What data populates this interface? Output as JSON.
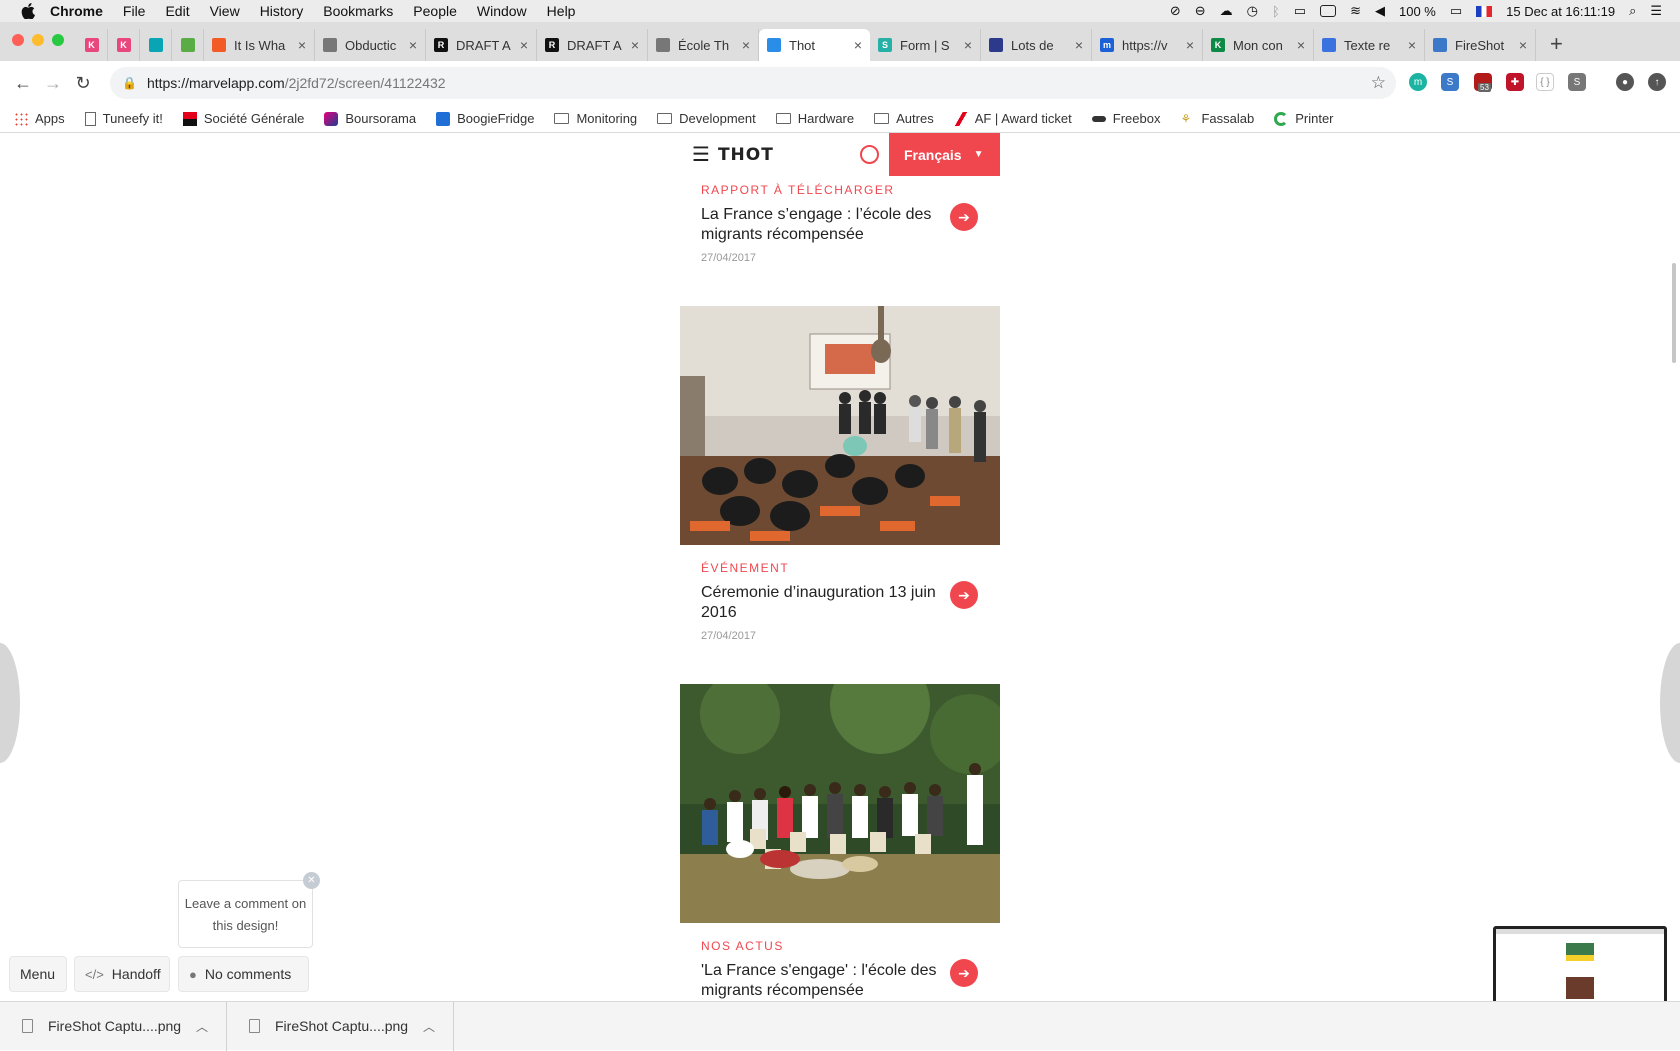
{
  "menubar": {
    "app": "Chrome",
    "items": [
      "File",
      "Edit",
      "View",
      "History",
      "Bookmarks",
      "People",
      "Window",
      "Help"
    ],
    "battery": "100 %",
    "datetime": "15 Dec at  16:11:19"
  },
  "tabs": [
    {
      "title": "",
      "color": "#e8467c",
      "letter": "K"
    },
    {
      "title": "",
      "color": "#e8467c",
      "letter": "K"
    },
    {
      "title": "",
      "color": "#0aa5b5",
      "letter": ""
    },
    {
      "title": "",
      "color": "#5aac44",
      "letter": ""
    },
    {
      "title": "It Is Wha",
      "color": "#f25b25",
      "letter": ""
    },
    {
      "title": "Obductic",
      "color": "#777777",
      "letter": ""
    },
    {
      "title": "DRAFT A",
      "color": "#111111",
      "letter": "R"
    },
    {
      "title": "DRAFT A",
      "color": "#111111",
      "letter": "R"
    },
    {
      "title": "École Th",
      "color": "#777777",
      "letter": ""
    },
    {
      "title": "Thot",
      "color": "#2a8ee8",
      "letter": "",
      "active": true
    },
    {
      "title": "Form | S",
      "color": "#27b0a6",
      "letter": "S"
    },
    {
      "title": "Lots de",
      "color": "#2d3a8c",
      "letter": ""
    },
    {
      "title": "https://v",
      "color": "#1c62d6",
      "letter": "m"
    },
    {
      "title": "Mon con",
      "color": "#0c8a46",
      "letter": "K"
    },
    {
      "title": "Texte re",
      "color": "#3a73e0",
      "letter": ""
    },
    {
      "title": "FireShot",
      "color": "#3c7ac9",
      "letter": ""
    }
  ],
  "toolbar": {
    "url_host": "https://marvelapp.com",
    "url_path": "/2j2fd72/screen/41122432",
    "ext_badge": "53"
  },
  "bookmarks": [
    "Apps",
    "Tuneefy it!",
    "Société Générale",
    "Boursorama",
    "BoogieFridge",
    "Monitoring",
    "Development",
    "Hardware",
    "Autres",
    "AF | Award ticket",
    "Freebox",
    "Fassalab",
    "Printer"
  ],
  "site": {
    "logo": "THOT",
    "language": "Français"
  },
  "cards": [
    {
      "category": "RAPPORT À TÉLÉCHARGER",
      "title": "La France s’engage : l’école des migrants récompensée",
      "date": "27/04/2017"
    },
    {
      "category": "ÉVÉNEMENT",
      "title": "Céremonie d’inauguration 13 juin 2016",
      "date": "27/04/2017"
    },
    {
      "category": "NOS ACTUS",
      "title": "'La France s'engage' : l'école des migrants récompensée",
      "date": ""
    }
  ],
  "marvel": {
    "tooltip": "Leave a comment on this design!",
    "menu_label": "Menu",
    "handoff_label": "Handoff",
    "comments_label": "No comments"
  },
  "downloads": [
    "FireShot Captu....png",
    "FireShot Captu....png"
  ],
  "colors": {
    "accent": "#f0474f",
    "chrome_tabstrip": "#dedede"
  }
}
